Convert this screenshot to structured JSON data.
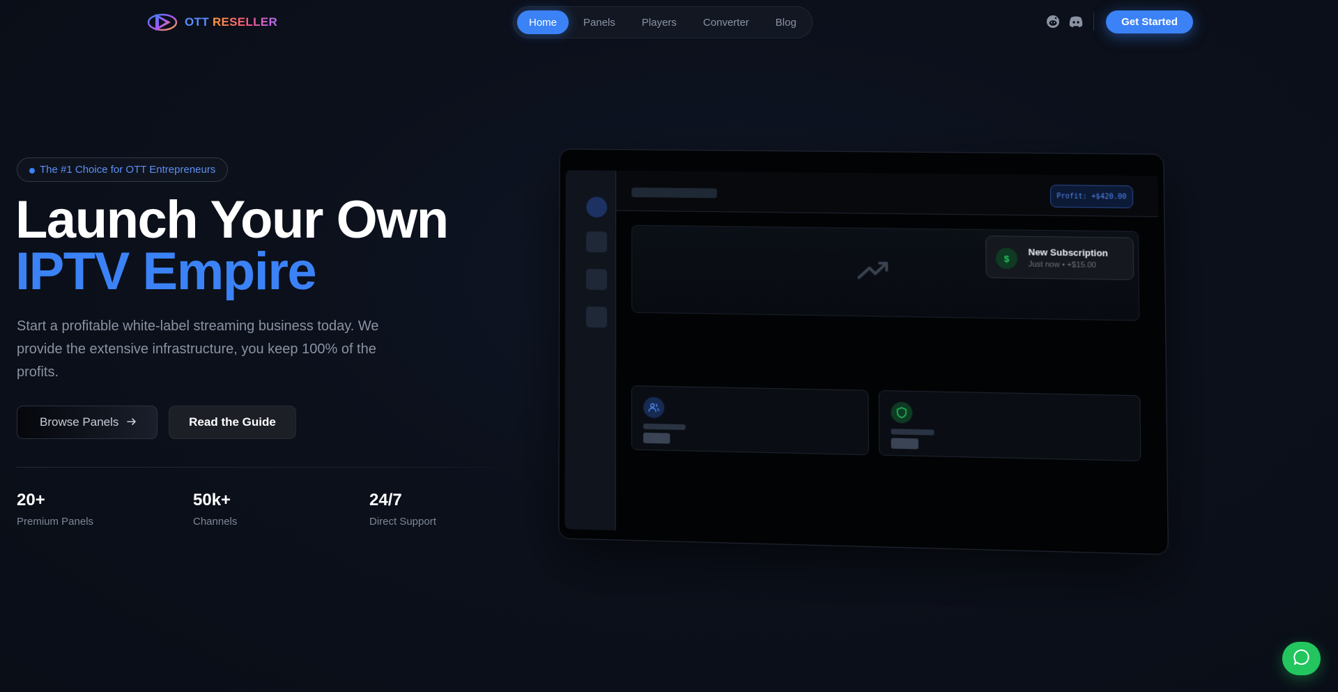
{
  "header": {
    "logo": {
      "part1": "OTT",
      "part2": "RESELLER"
    },
    "nav": [
      {
        "label": "Home",
        "active": true
      },
      {
        "label": "Panels",
        "active": false
      },
      {
        "label": "Players",
        "active": false
      },
      {
        "label": "Converter",
        "active": false
      },
      {
        "label": "Blog",
        "active": false
      }
    ],
    "social_icons": [
      "reddit-icon",
      "discord-icon"
    ],
    "cta_label": "Get Started"
  },
  "hero": {
    "badge": "The #1 Choice for OTT Entrepreneurs",
    "title_line1": "Launch Your Own",
    "title_line2": "IPTV Empire",
    "subtitle": "Start a profitable white-label streaming business today. We provide the extensive infrastructure, you keep 100% of the profits.",
    "primary_button": "Browse Panels",
    "secondary_button": "Read the Guide",
    "stats": [
      {
        "value": "20+",
        "label": "Premium Panels"
      },
      {
        "value": "50k+",
        "label": "Channels"
      },
      {
        "value": "24/7",
        "label": "Direct Support"
      }
    ]
  },
  "mockup": {
    "profit": "Profit: +$420.00",
    "notification_title": "New Subscription",
    "notification_sub": "Just now • +$15.00",
    "notification_icon": "$"
  },
  "colors": {
    "accent": "#3b82f6",
    "background": "#0b101b",
    "chat": "#22c55e"
  }
}
